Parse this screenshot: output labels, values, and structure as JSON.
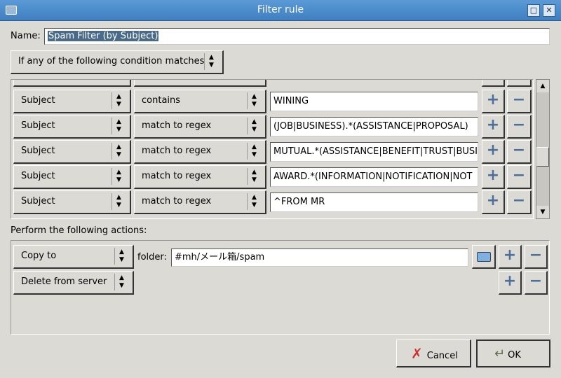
{
  "window": {
    "title": "Filter rule"
  },
  "name": {
    "label": "Name:",
    "value": "Spam Filter (by Subject)"
  },
  "match_mode": "If any of the following condition matches",
  "conditions": [
    {
      "field": "Subject",
      "op": "contains",
      "value": "WINING"
    },
    {
      "field": "Subject",
      "op": "match to regex",
      "value": "(JOB|BUSINESS).*(ASSISTANCE|PROPOSAL)"
    },
    {
      "field": "Subject",
      "op": "match to regex",
      "value": "MUTUAL.*(ASSISTANCE|BENEFIT|TRUST|BUSI"
    },
    {
      "field": "Subject",
      "op": "match to regex",
      "value": "AWARD.*(INFORMATION|NOTIFICATION|NOT"
    },
    {
      "field": "Subject",
      "op": "match to regex",
      "value": "^FROM MR"
    }
  ],
  "actions_label": "Perform the following actions:",
  "actions": [
    {
      "action": "Copy to",
      "folder_label": "folder:",
      "folder": "#mh/メール箱/spam"
    },
    {
      "action": "Delete from server"
    }
  ],
  "buttons": {
    "cancel": "Cancel",
    "ok": "OK"
  },
  "icons": {
    "add": "+",
    "remove": "−"
  }
}
